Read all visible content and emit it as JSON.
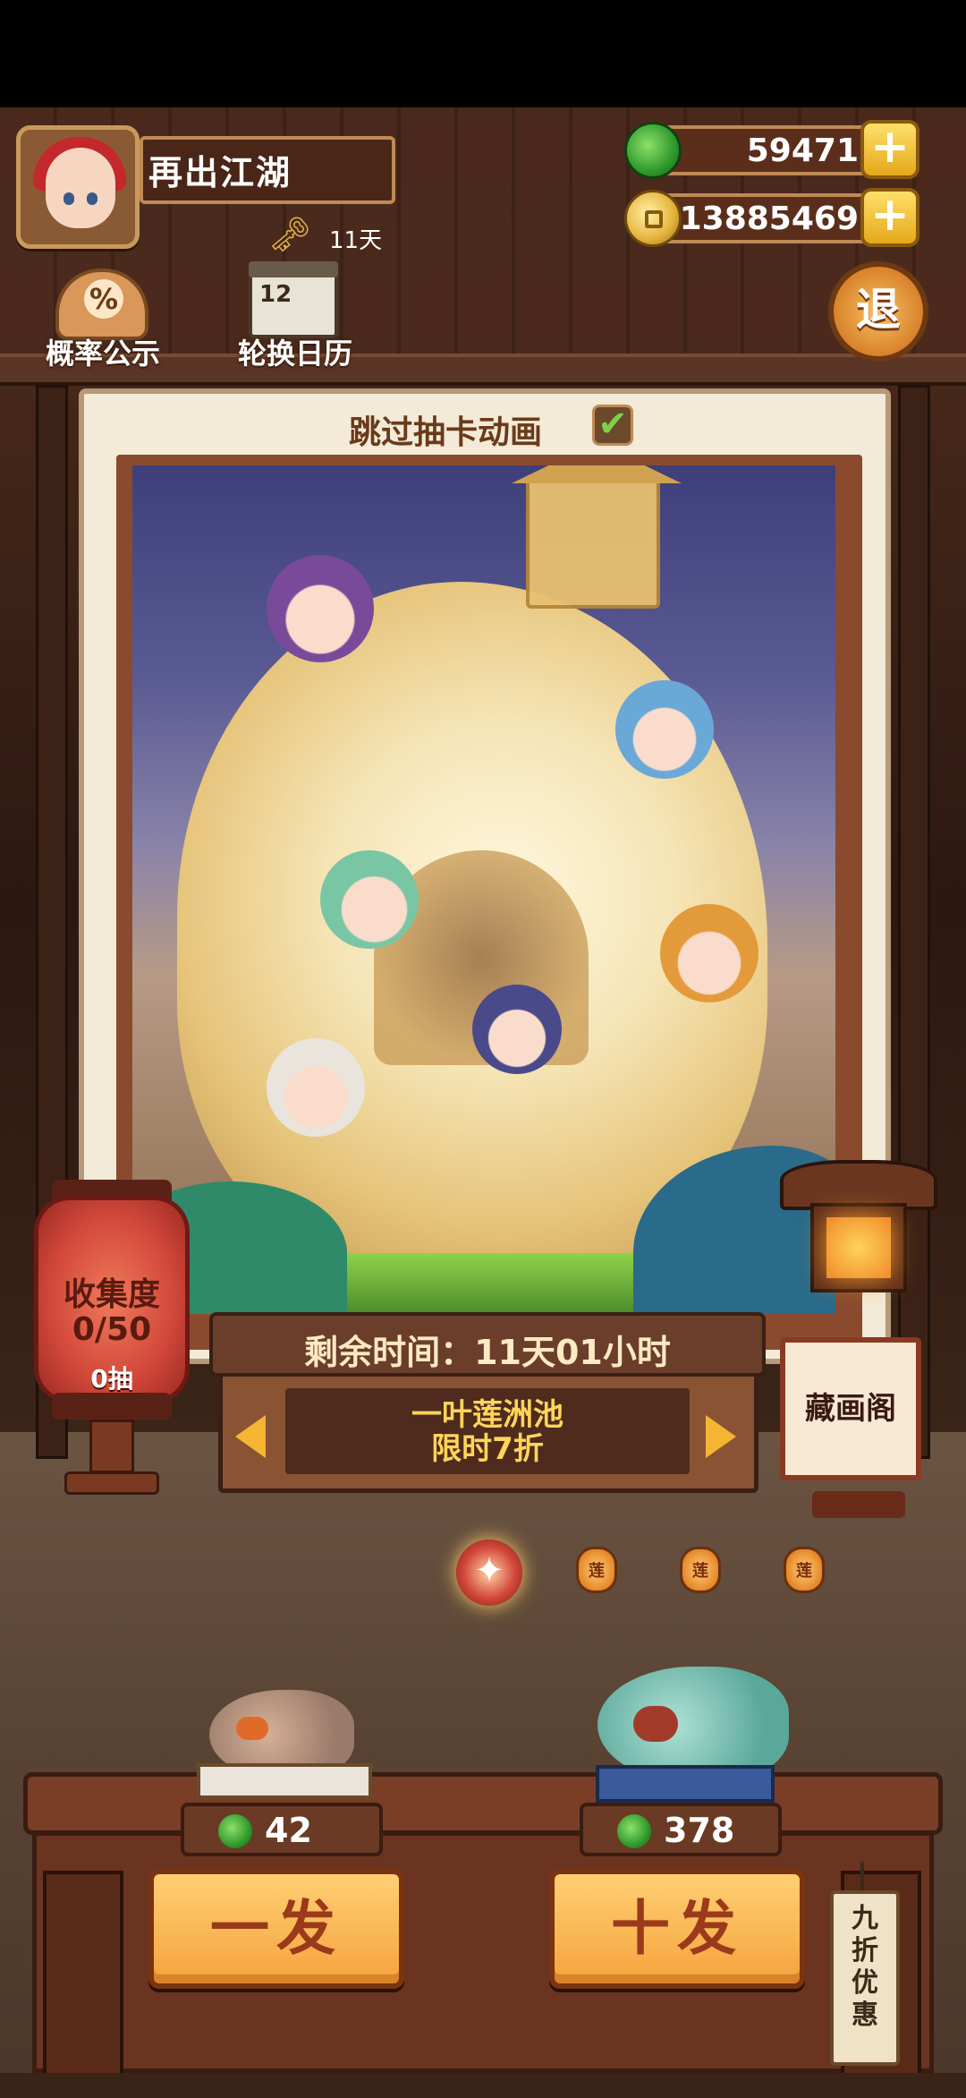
{
  "player": {
    "name": "再出江湖",
    "key_days": "11天"
  },
  "currency": {
    "jade": "59471",
    "coins": "13885469"
  },
  "top_menu": {
    "probability_label": "概率公示",
    "calendar_label": "轮换日历",
    "calendar_number": "12",
    "exit_label": "退"
  },
  "card": {
    "skip_animation_label": "跳过抽卡动画",
    "skip_checked": true
  },
  "collection": {
    "title": "收集度",
    "progress": "0/50",
    "pulls": "0抽"
  },
  "pool": {
    "timer": "剩余时间：11天01小时",
    "name": "一叶莲洲池",
    "discount": "限时7折"
  },
  "gallery": {
    "label": "藏画阁"
  },
  "indicators": {
    "active_index": 0,
    "lantern_glyph": "莲"
  },
  "pull": {
    "single": {
      "label": "一发",
      "cost": "42"
    },
    "ten": {
      "label": "十发",
      "cost": "378"
    },
    "discount_tag": "九折优惠"
  },
  "colors": {
    "accent": "#f5a23c",
    "jade": "#2f9a2c",
    "gold": "#ffd55a",
    "wood": "#6a3420"
  }
}
